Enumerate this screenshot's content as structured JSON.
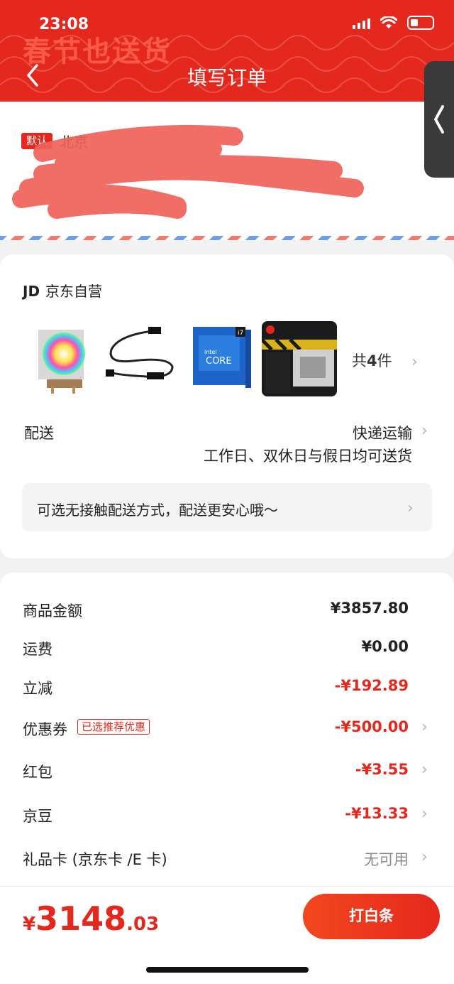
{
  "status_bar": {
    "time": "23:08"
  },
  "header": {
    "banner": "春节也送货",
    "title": "填写订单"
  },
  "address": {
    "default_tag": "默认",
    "line1": "北京",
    "line2": "",
    "line3": ""
  },
  "store": {
    "name_logo": "JD",
    "name": "京东自营",
    "products": [
      {
        "icon": "rgb-cpu-cooler"
      },
      {
        "icon": "argb-cable"
      },
      {
        "icon": "intel-core-i7-box"
      },
      {
        "icon": "msi-b660m-motherboard"
      }
    ],
    "count_prefix": "共",
    "count": "4",
    "count_suffix": "件"
  },
  "delivery": {
    "label": "配送",
    "method": "快递运输",
    "schedule": "工作日、双休日与假日均可送货",
    "contactless": "可选无接触配送方式，配送更安心哦～"
  },
  "summary": {
    "rows": [
      {
        "label": "商品金额",
        "value": "¥3857.80"
      },
      {
        "label": "运费",
        "value": "¥0.00"
      },
      {
        "label": "立减",
        "value": "-¥192.89"
      },
      {
        "label": "优惠券",
        "tag": "已选推荐优惠",
        "value": "-¥500.00"
      },
      {
        "label": "红包",
        "value": "-¥3.55"
      },
      {
        "label": "京豆",
        "value": "-¥13.33"
      },
      {
        "label": "礼品卡 (京东卡 /E 卡)",
        "value": "无可用"
      }
    ]
  },
  "footer": {
    "currency": "¥",
    "total_int": "3148",
    "total_dec": ".03",
    "pay_label": "打白条"
  },
  "colors": {
    "brand_red": "#e5281d",
    "banner_text": "#ff6a55"
  }
}
